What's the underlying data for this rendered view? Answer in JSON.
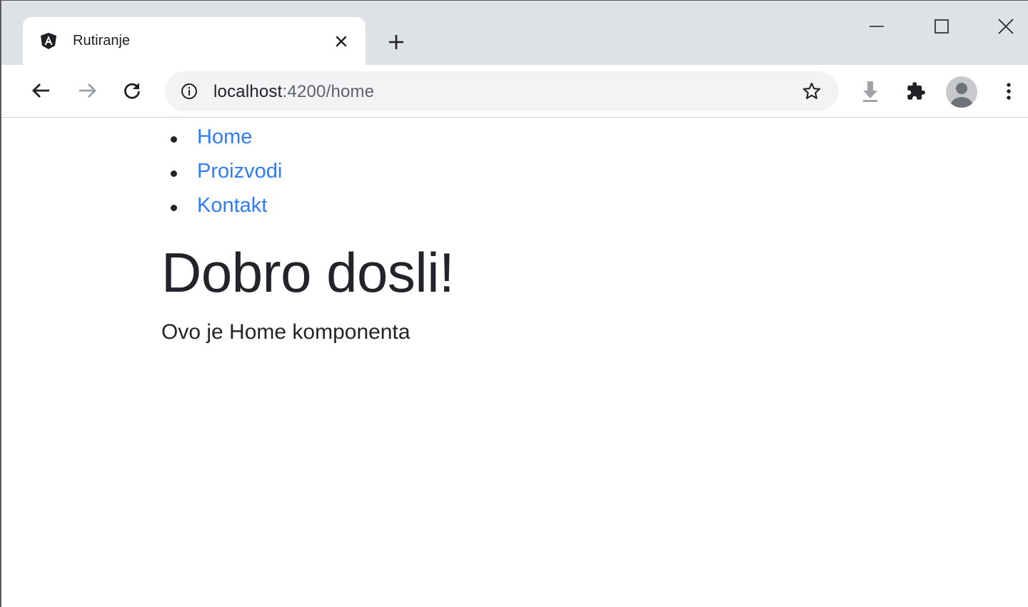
{
  "browser": {
    "tab": {
      "title": "Rutiranje",
      "favicon": "angular-logo-icon"
    },
    "url": {
      "host": "localhost",
      "rest": ":4200/home"
    },
    "icons": [
      "back-arrow-icon",
      "forward-arrow-icon",
      "reload-icon",
      "info-icon",
      "star-icon",
      "download-icon",
      "extensions-icon",
      "profile-icon",
      "kebab-menu-icon"
    ],
    "colors": {
      "tabstrip": "#dee1e6",
      "omnibox": "#f1f3f4",
      "link": "#2f7cf6",
      "text": "#212529"
    }
  },
  "page": {
    "nav": [
      {
        "label": "Home"
      },
      {
        "label": "Proizvodi"
      },
      {
        "label": "Kontakt"
      }
    ],
    "heading": "Dobro dosli!",
    "text": "Ovo je Home komponenta"
  }
}
